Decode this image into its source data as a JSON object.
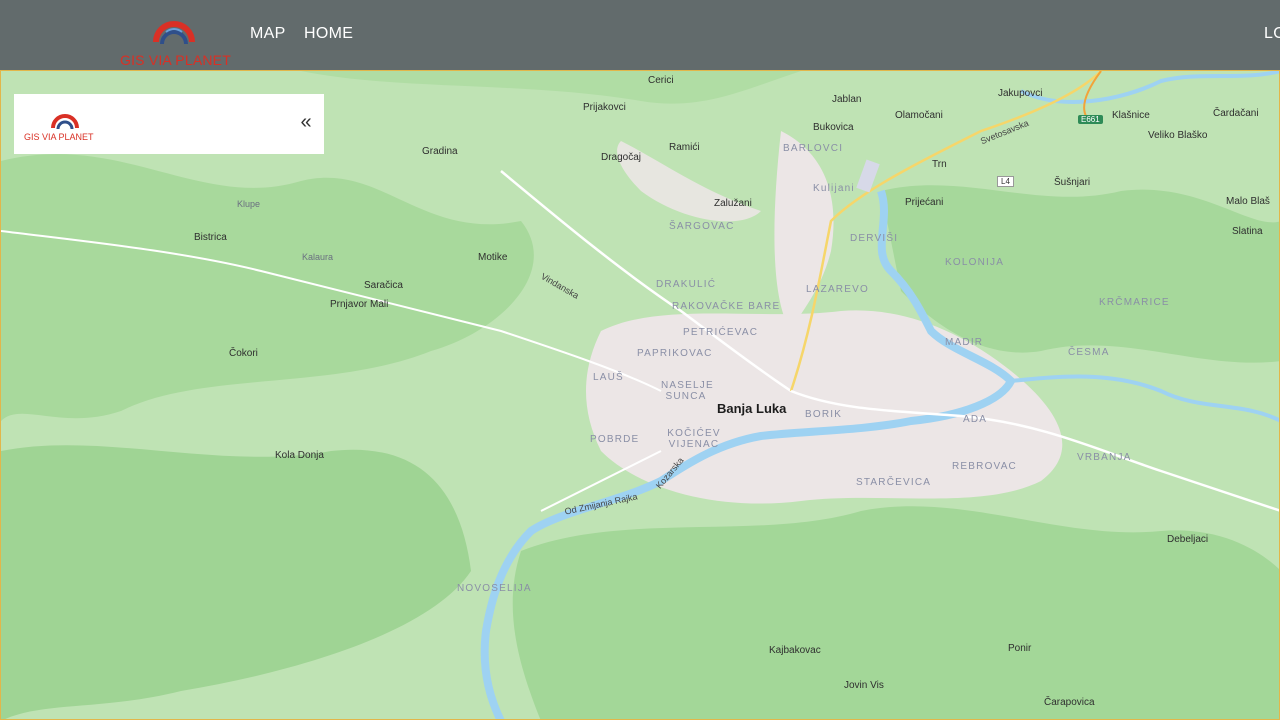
{
  "navbar": {
    "brand": "GIS VIA PLANET",
    "links": [
      "MAP",
      "HOME"
    ],
    "login": "LO"
  },
  "panel": {
    "brand": "GIS VIA PLANET",
    "collapse_icon": "«"
  },
  "map": {
    "city": "Banja Luka",
    "places": [
      "Cerici",
      "Jablan",
      "Jakupovci",
      "Prijakovci",
      "Olamočani",
      "Klašnice",
      "Čardačani",
      "Bukovica",
      "Veliko Blaško",
      "Gradina",
      "Ramići",
      "Dragočaj",
      "Trn",
      "Šušnjari",
      "Kulijani",
      "Prijećani",
      "Zalužani",
      "Malo Blaš",
      "Klupe",
      "Bistrica",
      "Slatina",
      "Kalaura",
      "Motike",
      "Saračica",
      "Prnjavor Mali",
      "Čokori",
      "Kola Donja",
      "Debeljaci",
      "Kajbakovac",
      "Ponir",
      "Jovin Vis",
      "Čarapovica"
    ],
    "districts": [
      "BARLOVCI",
      "ŠARGOVAC",
      "DERVIŠI",
      "KOLONIJA",
      "DRAKULIĆ",
      "LAZAREVO",
      "RAKOVAČKE BARE",
      "KRČMARICE",
      "PETRIĆEVAC",
      "MADIR",
      "ČESMA",
      "PAPRIKOVAC",
      "LAUŠ",
      "NASELJE SUNCA",
      "BORIK",
      "ADA",
      "POBRDE",
      "KOČIĆEV VIJENAC",
      "REBROVAC",
      "VRBANJA",
      "STARČEVICA",
      "NOVOSELIJA"
    ],
    "roads": [
      "Svetosavska",
      "Vindanska",
      "Kozarska",
      "Od Zmijanja Rajka"
    ],
    "shields": [
      "E661",
      "L4"
    ]
  }
}
